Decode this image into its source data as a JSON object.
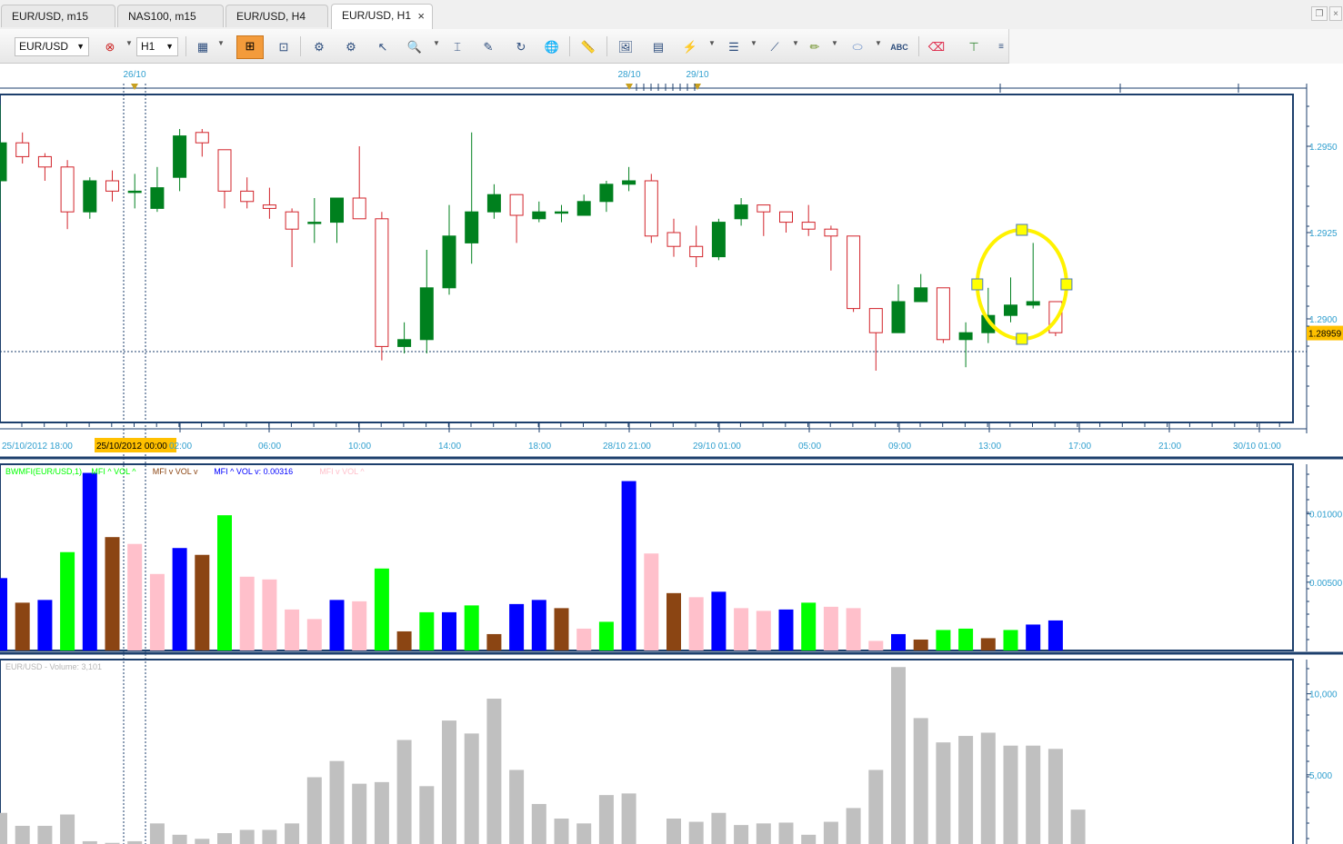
{
  "tabs": [
    {
      "label": "EUR/USD, m15",
      "active": false
    },
    {
      "label": "NAS100, m15",
      "active": false
    },
    {
      "label": "EUR/USD, H4",
      "active": false
    },
    {
      "label": "EUR/USD, H1",
      "active": true,
      "close_glyph": "×"
    }
  ],
  "toolbar": {
    "symbol": "EUR/USD",
    "timeframe": "H1",
    "icons": [
      "chart-properties-icon",
      "zoom-in-icon",
      "zoom-out-icon",
      "cursor-icon",
      "magnifier-icon",
      "crosshair-icon",
      "indicator-icon",
      "strategy-icon",
      "globe-icon",
      "ruler-icon",
      "image-icon",
      "template-icon",
      "fibonacci-icon",
      "horizontal-lines-icon",
      "trend-line-icon",
      "pencil-icon",
      "ellipse-icon",
      "text-icon",
      "eraser-icon",
      "hierarchy-icon",
      "more-icon"
    ]
  },
  "colors": {
    "grid_frame": "#1d3f6c",
    "axis_text": "#2f9fcf",
    "bear_candle": "#d2232a",
    "bull_candle": "#00801e",
    "highlight_ellipse": "#fff200",
    "bw_green": "#00ff00",
    "bw_brown": "#8b4513",
    "bw_blue": "#0000ff",
    "bw_pink": "#ffc0cb",
    "volume_gray": "#c0c0c0",
    "price_badge": "#ffc000"
  },
  "main_chart": {
    "top_markers": [
      "26/10",
      "28/10",
      "29/10"
    ],
    "price_ticks": [
      "1.2950",
      "1.2925",
      "1.2900"
    ],
    "current_price": "1.28959",
    "crosshair_date": "25/10/2012 00:00",
    "time_labels": [
      "25/10/2012 18:00",
      "02:00",
      "06:00",
      "10:00",
      "14:00",
      "18:00",
      "28/10 21:00",
      "29/10 01:00",
      "05:00",
      "09:00",
      "13:00",
      "17:00",
      "21:00",
      "30/10 01:00"
    ]
  },
  "indicator_panel": {
    "legend": [
      {
        "text": "BWMFI(EUR/USD,1)",
        "color": "#00ff00"
      },
      {
        "text": "MFI ^ VOL ^",
        "color": "#00ff00"
      },
      {
        "text": "MFI v VOL v",
        "color": "#8b4513"
      },
      {
        "text": "MFI ^ VOL v: 0.00316",
        "color": "#0000ff"
      },
      {
        "text": "MFI v VOL ^",
        "color": "#ffc0cb"
      }
    ],
    "ticks": [
      "0.01000",
      "0.00500"
    ]
  },
  "volume_panel": {
    "legend": "EUR/USD - Volume: 3,101",
    "ticks": [
      "10,000",
      "5,000"
    ]
  },
  "chart_data": [
    {
      "type": "candlestick",
      "title": "EUR/USD, H1",
      "ylim": [
        1.287,
        1.2965
      ],
      "last_price": 1.28959,
      "candles": [
        {
          "o": 1.294,
          "h": 1.2962,
          "l": 1.2928,
          "c": 1.2951
        },
        {
          "o": 1.2951,
          "h": 1.2954,
          "l": 1.2945,
          "c": 1.2947
        },
        {
          "o": 1.2947,
          "h": 1.2948,
          "l": 1.294,
          "c": 1.2944
        },
        {
          "o": 1.2944,
          "h": 1.2946,
          "l": 1.2926,
          "c": 1.2931
        },
        {
          "o": 1.2931,
          "h": 1.2941,
          "l": 1.2929,
          "c": 1.294
        },
        {
          "o": 1.294,
          "h": 1.2943,
          "l": 1.2934,
          "c": 1.2937
        },
        {
          "o": 1.2937,
          "h": 1.2942,
          "l": 1.2932,
          "c": 1.2937
        },
        {
          "o": 1.2932,
          "h": 1.2944,
          "l": 1.2931,
          "c": 1.2938
        },
        {
          "o": 1.2941,
          "h": 1.2955,
          "l": 1.2937,
          "c": 1.2953
        },
        {
          "o": 1.2954,
          "h": 1.2955,
          "l": 1.2947,
          "c": 1.2951
        },
        {
          "o": 1.2949,
          "h": 1.2949,
          "l": 1.2932,
          "c": 1.2937
        },
        {
          "o": 1.2937,
          "h": 1.2941,
          "l": 1.2932,
          "c": 1.2934
        },
        {
          "o": 1.2933,
          "h": 1.2938,
          "l": 1.2929,
          "c": 1.2932
        },
        {
          "o": 1.2931,
          "h": 1.2932,
          "l": 1.2915,
          "c": 1.2926
        },
        {
          "o": 1.2928,
          "h": 1.2935,
          "l": 1.2922,
          "c": 1.2928
        },
        {
          "o": 1.2928,
          "h": 1.2935,
          "l": 1.2922,
          "c": 1.2935
        },
        {
          "o": 1.2935,
          "h": 1.295,
          "l": 1.2929,
          "c": 1.2929
        },
        {
          "o": 1.2929,
          "h": 1.2931,
          "l": 1.2888,
          "c": 1.2892
        },
        {
          "o": 1.2892,
          "h": 1.2899,
          "l": 1.289,
          "c": 1.2894
        },
        {
          "o": 1.2894,
          "h": 1.292,
          "l": 1.289,
          "c": 1.2909
        },
        {
          "o": 1.2909,
          "h": 1.2933,
          "l": 1.2907,
          "c": 1.2924
        },
        {
          "o": 1.2922,
          "h": 1.2954,
          "l": 1.2916,
          "c": 1.2931
        },
        {
          "o": 1.2931,
          "h": 1.2939,
          "l": 1.2929,
          "c": 1.2936
        },
        {
          "o": 1.2936,
          "h": 1.2936,
          "l": 1.2922,
          "c": 1.293
        },
        {
          "o": 1.2929,
          "h": 1.2934,
          "l": 1.2928,
          "c": 1.2931
        },
        {
          "o": 1.2931,
          "h": 1.2933,
          "l": 1.2928,
          "c": 1.2931
        },
        {
          "o": 1.293,
          "h": 1.2936,
          "l": 1.293,
          "c": 1.2934
        },
        {
          "o": 1.2934,
          "h": 1.294,
          "l": 1.2931,
          "c": 1.2939
        },
        {
          "o": 1.2939,
          "h": 1.2944,
          "l": 1.2937,
          "c": 1.294
        },
        {
          "o": 1.294,
          "h": 1.2942,
          "l": 1.2922,
          "c": 1.2924
        },
        {
          "o": 1.2925,
          "h": 1.2929,
          "l": 1.2918,
          "c": 1.2921
        },
        {
          "o": 1.2921,
          "h": 1.2927,
          "l": 1.2915,
          "c": 1.2918
        },
        {
          "o": 1.2918,
          "h": 1.2929,
          "l": 1.2917,
          "c": 1.2928
        },
        {
          "o": 1.2929,
          "h": 1.2935,
          "l": 1.2927,
          "c": 1.2933
        },
        {
          "o": 1.2933,
          "h": 1.2933,
          "l": 1.2924,
          "c": 1.2931
        },
        {
          "o": 1.2931,
          "h": 1.2931,
          "l": 1.2925,
          "c": 1.2928
        },
        {
          "o": 1.2928,
          "h": 1.2933,
          "l": 1.2924,
          "c": 1.2926
        },
        {
          "o": 1.2926,
          "h": 1.2927,
          "l": 1.2914,
          "c": 1.2924
        },
        {
          "o": 1.2924,
          "h": 1.2924,
          "l": 1.2902,
          "c": 1.2903
        },
        {
          "o": 1.2903,
          "h": 1.2903,
          "l": 1.2885,
          "c": 1.2896
        },
        {
          "o": 1.2896,
          "h": 1.291,
          "l": 1.2896,
          "c": 1.2905
        },
        {
          "o": 1.2905,
          "h": 1.2913,
          "l": 1.2905,
          "c": 1.2909
        },
        {
          "o": 1.2909,
          "h": 1.2909,
          "l": 1.2893,
          "c": 1.2894
        },
        {
          "o": 1.2894,
          "h": 1.2899,
          "l": 1.2886,
          "c": 1.2896
        },
        {
          "o": 1.2896,
          "h": 1.2909,
          "l": 1.2893,
          "c": 1.2901
        },
        {
          "o": 1.2901,
          "h": 1.2912,
          "l": 1.2899,
          "c": 1.2904
        },
        {
          "o": 1.2904,
          "h": 1.2922,
          "l": 1.2903,
          "c": 1.2905
        },
        {
          "o": 1.2905,
          "h": 1.2905,
          "l": 1.2895,
          "c": 1.2896
        }
      ],
      "annotation": "ellipse around last candles"
    },
    {
      "type": "bar",
      "title": "BWMFI(EUR/USD,1)",
      "ylim": [
        0,
        0.0135
      ],
      "values": [
        0.0053,
        0.0035,
        0.0037,
        0.0072,
        0.013,
        0.0083,
        0.0078,
        0.0056,
        0.0075,
        0.007,
        0.0099,
        0.0054,
        0.0052,
        0.003,
        0.0023,
        0.0037,
        0.0036,
        0.006,
        0.0014,
        0.0028,
        0.0028,
        0.0033,
        0.0012,
        0.0034,
        0.0037,
        0.0031,
        0.0016,
        0.0021,
        0.0124,
        0.0071,
        0.0042,
        0.0039,
        0.0043,
        0.0031,
        0.0029,
        0.003,
        0.0035,
        0.0032,
        0.0031,
        0.0007,
        0.0012,
        0.0008,
        0.0015,
        0.0016,
        0.0009,
        0.0015,
        0.0019,
        0.0022
      ],
      "colors": [
        "blue",
        "brown",
        "blue",
        "green",
        "blue",
        "brown",
        "pink",
        "pink",
        "blue",
        "brown",
        "green",
        "pink",
        "pink",
        "pink",
        "pink",
        "blue",
        "pink",
        "green",
        "brown",
        "green",
        "blue",
        "green",
        "brown",
        "blue",
        "blue",
        "brown",
        "pink",
        "green",
        "blue",
        "pink",
        "brown",
        "pink",
        "blue",
        "pink",
        "pink",
        "blue",
        "green",
        "pink",
        "pink",
        "pink",
        "blue",
        "brown",
        "green",
        "green",
        "brown",
        "green",
        "blue",
        "blue"
      ]
    },
    {
      "type": "bar",
      "title": "EUR/USD - Volume",
      "ylim": [
        0,
        12000
      ],
      "values": [
        2650,
        1850,
        1850,
        2550,
        900,
        800,
        900,
        2000,
        1300,
        1050,
        1400,
        1600,
        1600,
        2000,
        4850,
        5850,
        4450,
        4550,
        7150,
        4300,
        8350,
        7550,
        9700,
        5300,
        3200,
        2300,
        2000,
        3750,
        3850,
        400,
        2300,
        2100,
        2650,
        1900,
        2000,
        2050,
        1300,
        2100,
        2950,
        5300,
        11650,
        8500,
        7000,
        7400,
        7600,
        6800,
        6800,
        6600,
        2850
      ]
    }
  ]
}
